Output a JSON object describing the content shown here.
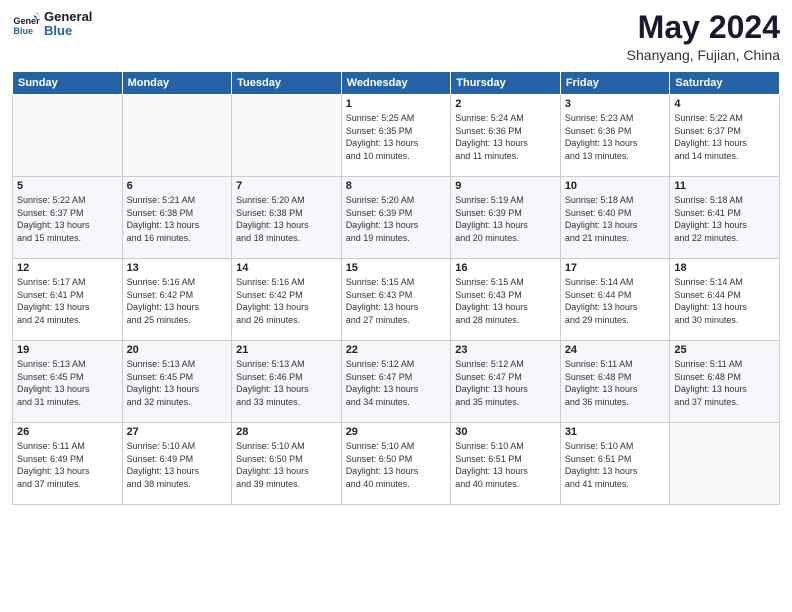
{
  "header": {
    "logo_line1": "General",
    "logo_line2": "Blue",
    "month_year": "May 2024",
    "location": "Shanyang, Fujian, China"
  },
  "days_of_week": [
    "Sunday",
    "Monday",
    "Tuesday",
    "Wednesday",
    "Thursday",
    "Friday",
    "Saturday"
  ],
  "weeks": [
    [
      {
        "day": "",
        "text": ""
      },
      {
        "day": "",
        "text": ""
      },
      {
        "day": "",
        "text": ""
      },
      {
        "day": "1",
        "text": "Sunrise: 5:25 AM\nSunset: 6:35 PM\nDaylight: 13 hours\nand 10 minutes."
      },
      {
        "day": "2",
        "text": "Sunrise: 5:24 AM\nSunset: 6:36 PM\nDaylight: 13 hours\nand 11 minutes."
      },
      {
        "day": "3",
        "text": "Sunrise: 5:23 AM\nSunset: 6:36 PM\nDaylight: 13 hours\nand 13 minutes."
      },
      {
        "day": "4",
        "text": "Sunrise: 5:22 AM\nSunset: 6:37 PM\nDaylight: 13 hours\nand 14 minutes."
      }
    ],
    [
      {
        "day": "5",
        "text": "Sunrise: 5:22 AM\nSunset: 6:37 PM\nDaylight: 13 hours\nand 15 minutes."
      },
      {
        "day": "6",
        "text": "Sunrise: 5:21 AM\nSunset: 6:38 PM\nDaylight: 13 hours\nand 16 minutes."
      },
      {
        "day": "7",
        "text": "Sunrise: 5:20 AM\nSunset: 6:38 PM\nDaylight: 13 hours\nand 18 minutes."
      },
      {
        "day": "8",
        "text": "Sunrise: 5:20 AM\nSunset: 6:39 PM\nDaylight: 13 hours\nand 19 minutes."
      },
      {
        "day": "9",
        "text": "Sunrise: 5:19 AM\nSunset: 6:39 PM\nDaylight: 13 hours\nand 20 minutes."
      },
      {
        "day": "10",
        "text": "Sunrise: 5:18 AM\nSunset: 6:40 PM\nDaylight: 13 hours\nand 21 minutes."
      },
      {
        "day": "11",
        "text": "Sunrise: 5:18 AM\nSunset: 6:41 PM\nDaylight: 13 hours\nand 22 minutes."
      }
    ],
    [
      {
        "day": "12",
        "text": "Sunrise: 5:17 AM\nSunset: 6:41 PM\nDaylight: 13 hours\nand 24 minutes."
      },
      {
        "day": "13",
        "text": "Sunrise: 5:16 AM\nSunset: 6:42 PM\nDaylight: 13 hours\nand 25 minutes."
      },
      {
        "day": "14",
        "text": "Sunrise: 5:16 AM\nSunset: 6:42 PM\nDaylight: 13 hours\nand 26 minutes."
      },
      {
        "day": "15",
        "text": "Sunrise: 5:15 AM\nSunset: 6:43 PM\nDaylight: 13 hours\nand 27 minutes."
      },
      {
        "day": "16",
        "text": "Sunrise: 5:15 AM\nSunset: 6:43 PM\nDaylight: 13 hours\nand 28 minutes."
      },
      {
        "day": "17",
        "text": "Sunrise: 5:14 AM\nSunset: 6:44 PM\nDaylight: 13 hours\nand 29 minutes."
      },
      {
        "day": "18",
        "text": "Sunrise: 5:14 AM\nSunset: 6:44 PM\nDaylight: 13 hours\nand 30 minutes."
      }
    ],
    [
      {
        "day": "19",
        "text": "Sunrise: 5:13 AM\nSunset: 6:45 PM\nDaylight: 13 hours\nand 31 minutes."
      },
      {
        "day": "20",
        "text": "Sunrise: 5:13 AM\nSunset: 6:45 PM\nDaylight: 13 hours\nand 32 minutes."
      },
      {
        "day": "21",
        "text": "Sunrise: 5:13 AM\nSunset: 6:46 PM\nDaylight: 13 hours\nand 33 minutes."
      },
      {
        "day": "22",
        "text": "Sunrise: 5:12 AM\nSunset: 6:47 PM\nDaylight: 13 hours\nand 34 minutes."
      },
      {
        "day": "23",
        "text": "Sunrise: 5:12 AM\nSunset: 6:47 PM\nDaylight: 13 hours\nand 35 minutes."
      },
      {
        "day": "24",
        "text": "Sunrise: 5:11 AM\nSunset: 6:48 PM\nDaylight: 13 hours\nand 36 minutes."
      },
      {
        "day": "25",
        "text": "Sunrise: 5:11 AM\nSunset: 6:48 PM\nDaylight: 13 hours\nand 37 minutes."
      }
    ],
    [
      {
        "day": "26",
        "text": "Sunrise: 5:11 AM\nSunset: 6:49 PM\nDaylight: 13 hours\nand 37 minutes."
      },
      {
        "day": "27",
        "text": "Sunrise: 5:10 AM\nSunset: 6:49 PM\nDaylight: 13 hours\nand 38 minutes."
      },
      {
        "day": "28",
        "text": "Sunrise: 5:10 AM\nSunset: 6:50 PM\nDaylight: 13 hours\nand 39 minutes."
      },
      {
        "day": "29",
        "text": "Sunrise: 5:10 AM\nSunset: 6:50 PM\nDaylight: 13 hours\nand 40 minutes."
      },
      {
        "day": "30",
        "text": "Sunrise: 5:10 AM\nSunset: 6:51 PM\nDaylight: 13 hours\nand 40 minutes."
      },
      {
        "day": "31",
        "text": "Sunrise: 5:10 AM\nSunset: 6:51 PM\nDaylight: 13 hours\nand 41 minutes."
      },
      {
        "day": "",
        "text": ""
      }
    ]
  ]
}
